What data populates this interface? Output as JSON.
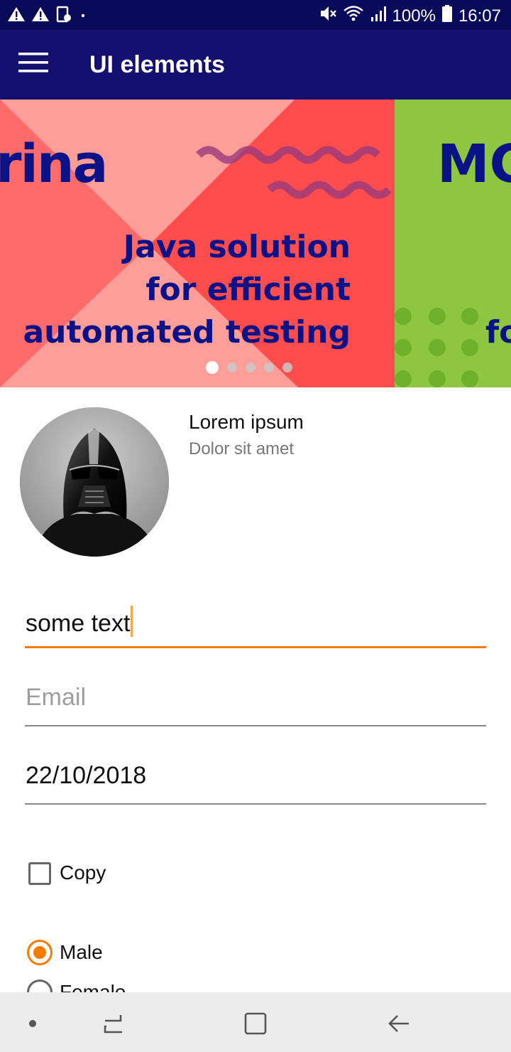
{
  "status_bar": {
    "battery": "100%",
    "time": "16:07",
    "icons": [
      "warning-icon",
      "warning-icon",
      "screenshot-icon",
      "notification-dot-icon",
      "mute-icon",
      "wifi-icon",
      "signal-icon",
      "battery-icon"
    ]
  },
  "app_bar": {
    "title": "UI elements",
    "menu_icon": "hamburger-menu-icon"
  },
  "carousel": {
    "slides": [
      {
        "brand_fragment": "rina",
        "headline": [
          "Java solution",
          "for efficient",
          "automated testing"
        ],
        "colors": {
          "background": "#ff4c4c",
          "light": "#ff9e99",
          "mid": "#ff6b6b",
          "text": "#0a1287",
          "wave": "#9a3a7a"
        }
      },
      {
        "brand_fragment": "MC",
        "headline_fragment": "fo",
        "colors": {
          "background": "#8dc63f",
          "dots": "#6fb02a",
          "text": "#0a1287"
        }
      }
    ],
    "page_count": 5,
    "active_page": 1
  },
  "profile": {
    "title": "Lorem ipsum",
    "subtitle": "Dolor sit amet",
    "avatar_icon": "darth-vader-avatar"
  },
  "form": {
    "text_field_value": "some text",
    "email_placeholder": "Email",
    "date_value": "22/10/2018",
    "checkbox_label": "Copy",
    "checkbox_checked": false,
    "radio_options": [
      {
        "label": "Male",
        "checked": true
      },
      {
        "label": "Female",
        "checked": false
      }
    ],
    "accent_color": "#f57c00"
  },
  "nav_bar": {
    "buttons": [
      "dot-icon",
      "recent-apps-icon",
      "home-icon",
      "back-icon"
    ]
  }
}
